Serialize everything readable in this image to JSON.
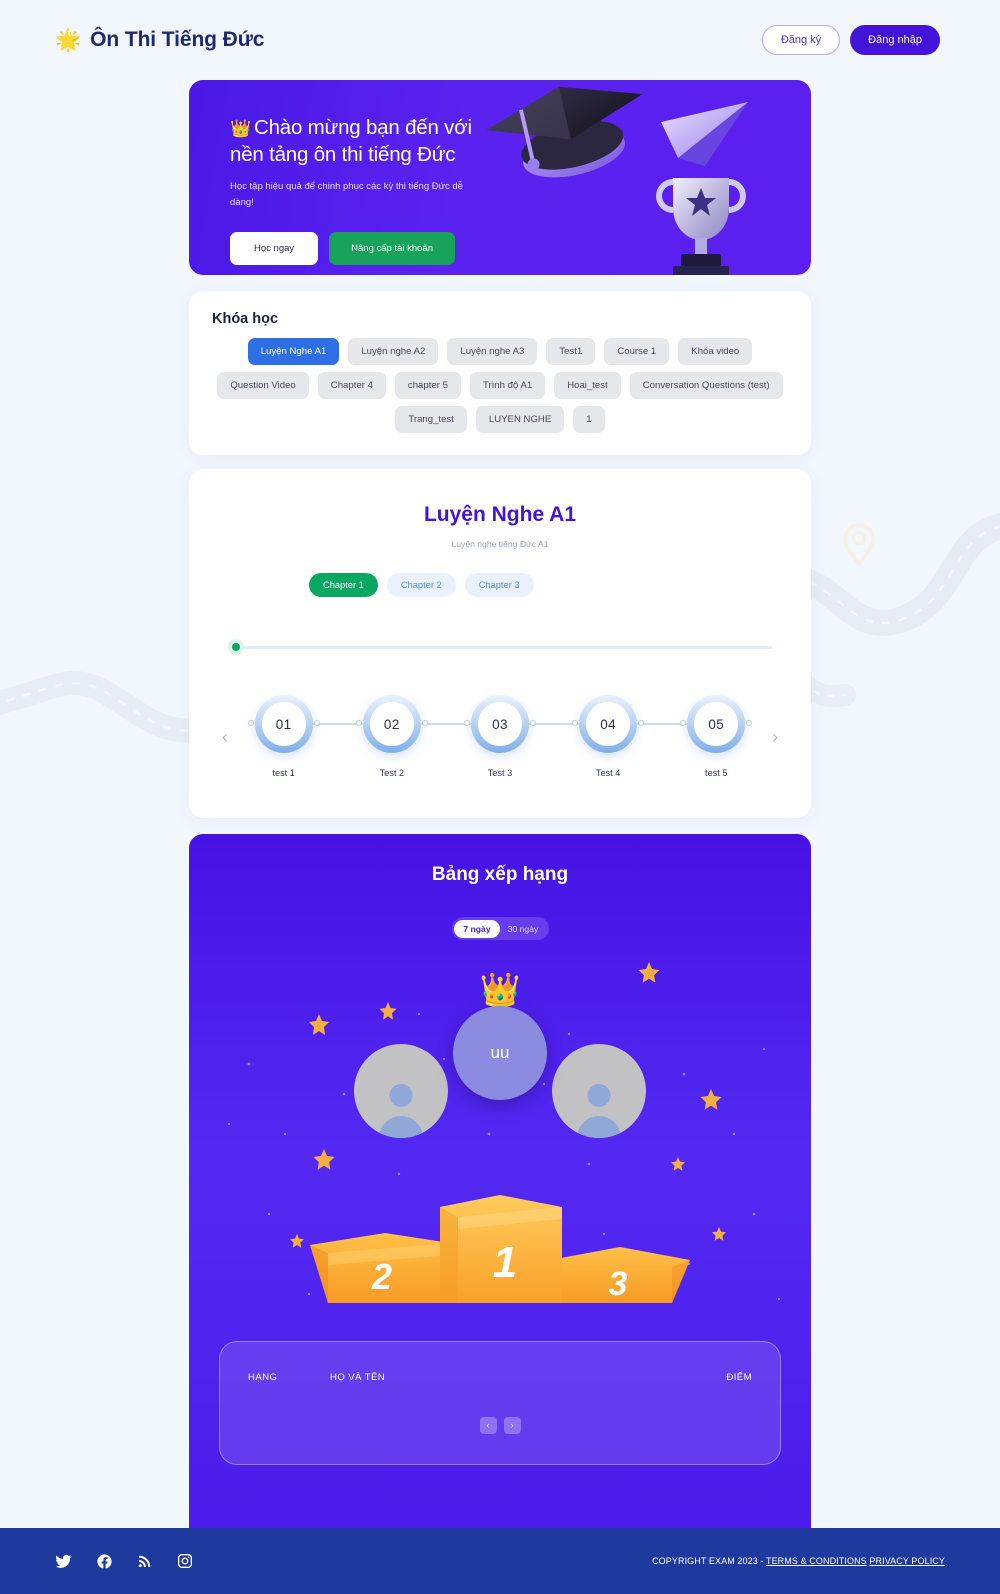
{
  "header": {
    "logo_icon": "star-badge-icon",
    "brand": "Ôn Thi Tiếng Đức",
    "register_label": "Đăng ký",
    "login_label": "Đăng nhập"
  },
  "hero": {
    "crown_icon": "crown-icon",
    "title_line1": "Chào mừng bạn đến với",
    "title_line2": "nền tảng ôn thi tiếng Đức",
    "subtitle": "Học tập hiệu quả để chinh phục các kỳ thi tiếng Đức dễ dàng!",
    "primary_btn": "Học ngay",
    "secondary_btn": "Nâng cấp tài khoản",
    "accent_green": "#17a359",
    "bg_purple": "#4b18e6"
  },
  "courses": {
    "title": "Khóa học",
    "active_color": "#2f6fe4",
    "items": [
      {
        "label": "Luyện Nghe A1",
        "active": true
      },
      {
        "label": "Luyện nghe A2",
        "active": false
      },
      {
        "label": "Luyện nghe A3",
        "active": false
      },
      {
        "label": "Test1",
        "active": false
      },
      {
        "label": "Course 1",
        "active": false
      },
      {
        "label": "Khóa video",
        "active": false
      },
      {
        "label": "Question Video",
        "active": false
      },
      {
        "label": "Chapter 4",
        "active": false
      },
      {
        "label": "chapter 5",
        "active": false
      },
      {
        "label": "Trình độ A1",
        "active": false
      },
      {
        "label": "Hoai_test",
        "active": false
      },
      {
        "label": "Conversation Questions (test)",
        "active": false
      },
      {
        "label": "Trang_test",
        "active": false
      },
      {
        "label": "LUYEN NGHE",
        "active": false
      },
      {
        "label": "1",
        "active": false
      }
    ]
  },
  "course_detail": {
    "title": "Luyện Nghe A1",
    "subtitle": "Luyện nghe tiếng Đức A1",
    "title_color": "#4213d9",
    "chapters": [
      {
        "label": "Chapter 1",
        "active": true
      },
      {
        "label": "Chapter 2",
        "active": false
      },
      {
        "label": "Chapter 3",
        "active": false
      }
    ],
    "progress_percent": 0,
    "prev_icon": "chevron-left-icon",
    "next_icon": "chevron-right-icon",
    "tests": [
      {
        "number": "01",
        "label": "test 1"
      },
      {
        "number": "02",
        "label": "Test 2"
      },
      {
        "number": "03",
        "label": "Test 3"
      },
      {
        "number": "04",
        "label": "Test 4"
      },
      {
        "number": "05",
        "label": "test 5"
      }
    ]
  },
  "leaderboard": {
    "title": "Bảng xếp hạng",
    "range_options": [
      {
        "label": "7 ngày",
        "active": true
      },
      {
        "label": "30 ngày",
        "active": false
      }
    ],
    "crown_icon": "crown-icon",
    "first_place_name": "uu",
    "second_place_name": "",
    "third_place_name": "",
    "podium_labels": {
      "first": "1",
      "second": "2",
      "third": "3"
    },
    "table": {
      "columns": [
        "HẠNG",
        "HỌ VÀ TÊN",
        "ĐIỂM"
      ],
      "rows": []
    },
    "pager": {
      "prev": "‹",
      "next": "›"
    },
    "bg_purple": "#4c1ce9"
  },
  "footer": {
    "social": [
      {
        "name": "twitter-icon"
      },
      {
        "name": "facebook-icon"
      },
      {
        "name": "rss-icon"
      },
      {
        "name": "instagram-icon"
      }
    ],
    "copyright": "COPYRIGHT EXAM 2023 -",
    "terms": "TERMS & CONDITIONS",
    "privacy": "PRIVACY POLICY",
    "bg": "#1e3a9e"
  }
}
